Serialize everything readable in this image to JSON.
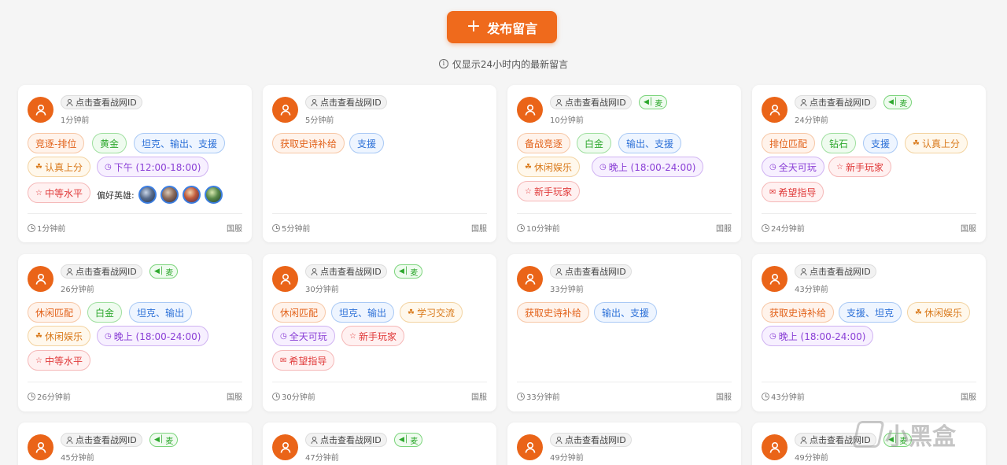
{
  "header": {
    "publish_label": "发布留言",
    "notice_text": "仅显示24小时内的最新留言"
  },
  "colors": {
    "accent": "#ef6a1c"
  },
  "watermark": "小黑盒",
  "cards": [
    {
      "id_label": "点击查看战网ID",
      "mic": "",
      "time": "1分钟前",
      "tags": [
        {
          "label": "竞逐-排位",
          "tone": "orange",
          "icon": ""
        },
        {
          "label": "黄金",
          "tone": "green",
          "icon": ""
        },
        {
          "label": "坦克、输出、支援",
          "tone": "blue",
          "icon": ""
        },
        {
          "label": "认真上分",
          "tone": "yellow",
          "icon": "trophy"
        },
        {
          "label": "下午 (12:00-18:00)",
          "tone": "purple",
          "icon": "clock"
        },
        {
          "label": "中等水平",
          "tone": "red",
          "icon": "star"
        }
      ],
      "preferred_heroes_label": "偏好英雄:",
      "foot_time": "1分钟前",
      "region": "国服"
    },
    {
      "id_label": "点击查看战网ID",
      "mic": "",
      "time": "5分钟前",
      "tags": [
        {
          "label": "获取史诗补给",
          "tone": "orange",
          "icon": ""
        },
        {
          "label": "支援",
          "tone": "blue",
          "icon": ""
        }
      ],
      "foot_time": "5分钟前",
      "region": "国服"
    },
    {
      "id_label": "点击查看战网ID",
      "mic": "麦",
      "time": "10分钟前",
      "tags": [
        {
          "label": "备战竞逐",
          "tone": "orange",
          "icon": ""
        },
        {
          "label": "白金",
          "tone": "green",
          "icon": ""
        },
        {
          "label": "输出、支援",
          "tone": "blue",
          "icon": ""
        },
        {
          "label": "休闲娱乐",
          "tone": "yellow",
          "icon": "trophy"
        },
        {
          "label": "晚上 (18:00-24:00)",
          "tone": "purple",
          "icon": "clock"
        },
        {
          "label": "新手玩家",
          "tone": "red",
          "icon": "star"
        }
      ],
      "foot_time": "10分钟前",
      "region": "国服"
    },
    {
      "id_label": "点击查看战网ID",
      "mic": "麦",
      "time": "24分钟前",
      "tags": [
        {
          "label": "排位匹配",
          "tone": "orange",
          "icon": ""
        },
        {
          "label": "钻石",
          "tone": "green",
          "icon": ""
        },
        {
          "label": "支援",
          "tone": "blue",
          "icon": ""
        },
        {
          "label": "认真上分",
          "tone": "yellow",
          "icon": "trophy"
        },
        {
          "label": "全天可玩",
          "tone": "purple",
          "icon": "clock"
        },
        {
          "label": "新手玩家",
          "tone": "red",
          "icon": "star"
        },
        {
          "label": "希望指导",
          "tone": "red",
          "icon": "chat"
        }
      ],
      "foot_time": "24分钟前",
      "region": "国服"
    },
    {
      "id_label": "点击查看战网ID",
      "mic": "麦",
      "time": "26分钟前",
      "tags": [
        {
          "label": "休闲匹配",
          "tone": "orange",
          "icon": ""
        },
        {
          "label": "白金",
          "tone": "green",
          "icon": ""
        },
        {
          "label": "坦克、输出",
          "tone": "blue",
          "icon": ""
        },
        {
          "label": "休闲娱乐",
          "tone": "yellow",
          "icon": "trophy"
        },
        {
          "label": "晚上 (18:00-24:00)",
          "tone": "purple",
          "icon": "clock"
        },
        {
          "label": "中等水平",
          "tone": "red",
          "icon": "star"
        }
      ],
      "foot_time": "26分钟前",
      "region": "国服"
    },
    {
      "id_label": "点击查看战网ID",
      "mic": "麦",
      "time": "30分钟前",
      "tags": [
        {
          "label": "休闲匹配",
          "tone": "orange",
          "icon": ""
        },
        {
          "label": "坦克、输出",
          "tone": "blue",
          "icon": ""
        },
        {
          "label": "学习交流",
          "tone": "yellow",
          "icon": "trophy"
        },
        {
          "label": "全天可玩",
          "tone": "purple",
          "icon": "clock"
        },
        {
          "label": "新手玩家",
          "tone": "red",
          "icon": "star"
        },
        {
          "label": "希望指导",
          "tone": "red",
          "icon": "chat"
        }
      ],
      "foot_time": "30分钟前",
      "region": "国服"
    },
    {
      "id_label": "点击查看战网ID",
      "mic": "",
      "time": "33分钟前",
      "tags": [
        {
          "label": "获取史诗补给",
          "tone": "orange",
          "icon": ""
        },
        {
          "label": "输出、支援",
          "tone": "blue",
          "icon": ""
        }
      ],
      "foot_time": "33分钟前",
      "region": "国服"
    },
    {
      "id_label": "点击查看战网ID",
      "mic": "",
      "time": "43分钟前",
      "tags": [
        {
          "label": "获取史诗补给",
          "tone": "orange",
          "icon": ""
        },
        {
          "label": "支援、坦克",
          "tone": "blue",
          "icon": ""
        },
        {
          "label": "休闲娱乐",
          "tone": "yellow",
          "icon": "trophy"
        },
        {
          "label": "晚上 (18:00-24:00)",
          "tone": "purple",
          "icon": "clock"
        }
      ],
      "foot_time": "43分钟前",
      "region": "国服"
    },
    {
      "id_label": "点击查看战网ID",
      "mic": "麦",
      "time": "45分钟前",
      "tags": []
    },
    {
      "id_label": "点击查看战网ID",
      "mic": "麦",
      "time": "47分钟前",
      "tags": []
    },
    {
      "id_label": "点击查看战网ID",
      "mic": "",
      "time": "49分钟前",
      "tags": []
    },
    {
      "id_label": "点击查看战网ID",
      "mic": "麦",
      "time": "49分钟前",
      "tags": []
    }
  ]
}
